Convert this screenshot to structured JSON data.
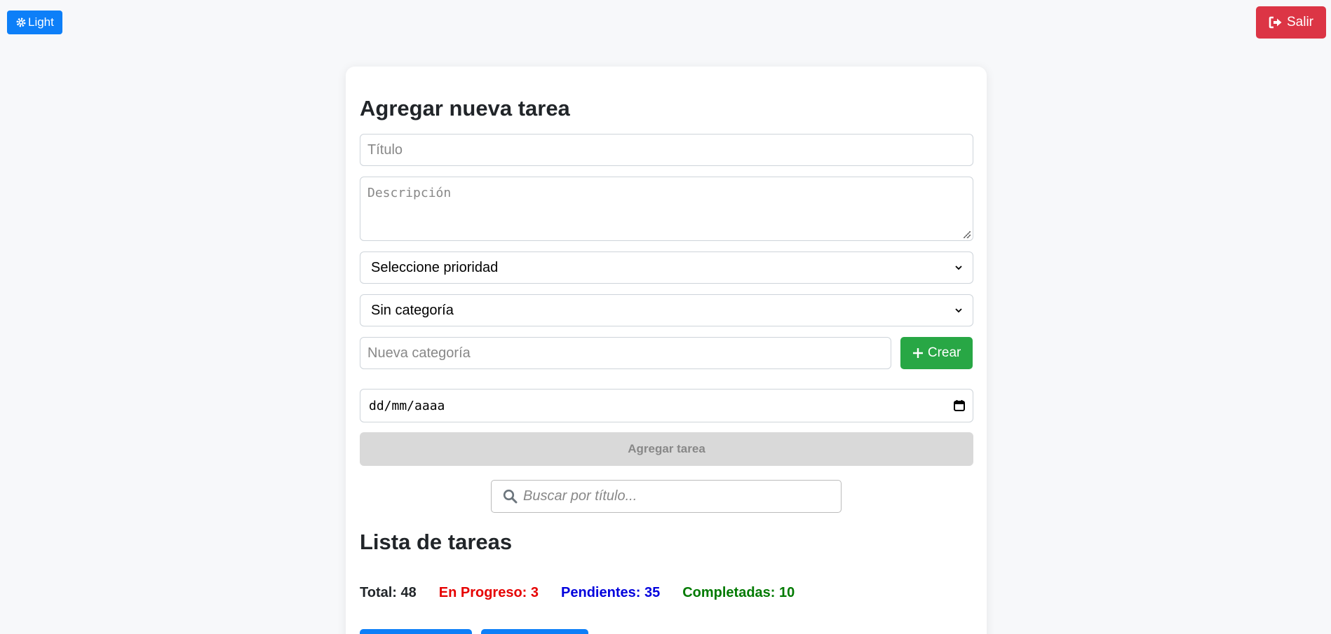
{
  "header": {
    "theme_label": "Light",
    "logout_label": "Salir"
  },
  "form": {
    "heading": "Agregar nueva tarea",
    "title_placeholder": "Título",
    "description_placeholder": "Descripción",
    "priority_selected": "Seleccione prioridad",
    "category_selected": "Sin categoría",
    "new_category_placeholder": "Nueva categoría",
    "create_label": "Crear",
    "date_placeholder": "dd/mm/aaaa",
    "submit_label": "Agregar tarea"
  },
  "search": {
    "placeholder": "Buscar por título..."
  },
  "list": {
    "heading": "Lista de tareas",
    "stats": {
      "total": "Total: 48",
      "in_progress": "En Progreso: 3",
      "pending": "Pendientes: 35",
      "completed": "Completadas: 10"
    }
  },
  "colors": {
    "primary": "#0d7ff8",
    "danger": "#dc3545",
    "success": "#28a745",
    "in_progress": "#e60000",
    "pending": "#0000dd",
    "completed": "#007a00"
  },
  "icons": {
    "theme": "gear-icon",
    "logout": "sign-out-icon",
    "create": "plus-icon",
    "date": "calendar-icon",
    "search": "search-icon",
    "select": "chevron-down-icon"
  }
}
